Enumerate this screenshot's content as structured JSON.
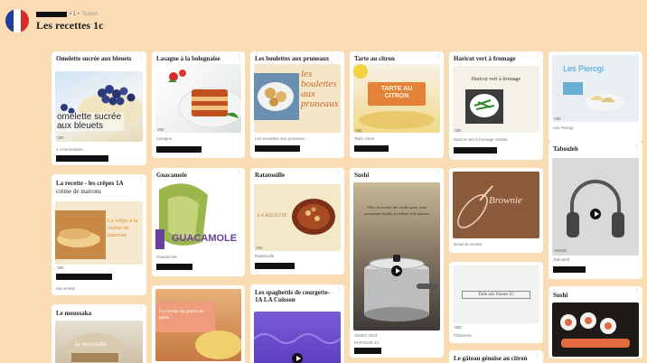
{
  "header": {
    "author_suffix": "• 1 •",
    "author_note": "Suivre",
    "board_title": "Les recettes 1c",
    "flag_colors": [
      "#1f3d99",
      "#ffffff",
      "#d72a2a"
    ]
  },
  "cards": {
    "omelette": {
      "title": "Omelette sucrée aux bleuets",
      "overlay": "omelette sucrée aux bleuets",
      "badge": "VID",
      "meta": "1 commentaire"
    },
    "lasagne": {
      "title": "Lasagne à la bolognaise",
      "meta": "Lasagne"
    },
    "boulettes": {
      "title": "Les boulettes aux pruneaux",
      "overlay": "les boulettes aux pruneaux",
      "meta": "Les boulettes aux pruneaux"
    },
    "tarte": {
      "title": "Tarte au citron",
      "overlay": "TARTE AU CITRON",
      "meta": "Tarte citron"
    },
    "haricot": {
      "title": "Haricot vert à fromage",
      "overlay": "Haricot vert à fromage",
      "meta": "Haricot vert à fromage recette"
    },
    "pierogi": {
      "title": "",
      "overlay": "Les Pierogi",
      "meta": "Les Pierogi"
    },
    "crepes": {
      "title": "La recette - les crêpes 1A",
      "subtitle": "crème de marrons",
      "overlay": "La crêpe à la crème de marrons",
      "meta": "Ma recette"
    },
    "guacamole": {
      "title": "Guacamole",
      "overlay": "GUACAMOLE",
      "meta": "Guacamole"
    },
    "ratatouille": {
      "title": "Ratatouille",
      "overlay": "LA RECETTE",
      "meta": "Ratatouille"
    },
    "sushi": {
      "title": "Sushi",
      "overlay": "Voici la recette des sushis pour trois personnes faciles à réaliser à la maison",
      "meta": "VIDEO 2023",
      "meta2": "PARTAGE 1C"
    },
    "brownie": {
      "title": "",
      "overlay": "Brownie",
      "meta": "Brownie recette"
    },
    "tabouleh": {
      "title": "Tabouleh",
      "meta": "Tabouleh"
    },
    "mousaka": {
      "title": "Le moussaka",
      "overlay": "la moussaka"
    },
    "riz": {
      "title": "",
      "overlay": "Tarte aux fraises 1C",
      "meta": "Pâtisserie"
    },
    "spaghetti": {
      "title": "Les spaghettis de courgette-1A LA Cuisson"
    },
    "pasta": {
      "title": "",
      "overlay": "La recette du gratin de pâtes"
    },
    "sushi2": {
      "title": "Sushi"
    },
    "gateau": {
      "title": "Le gâteau génoise au citron"
    }
  }
}
